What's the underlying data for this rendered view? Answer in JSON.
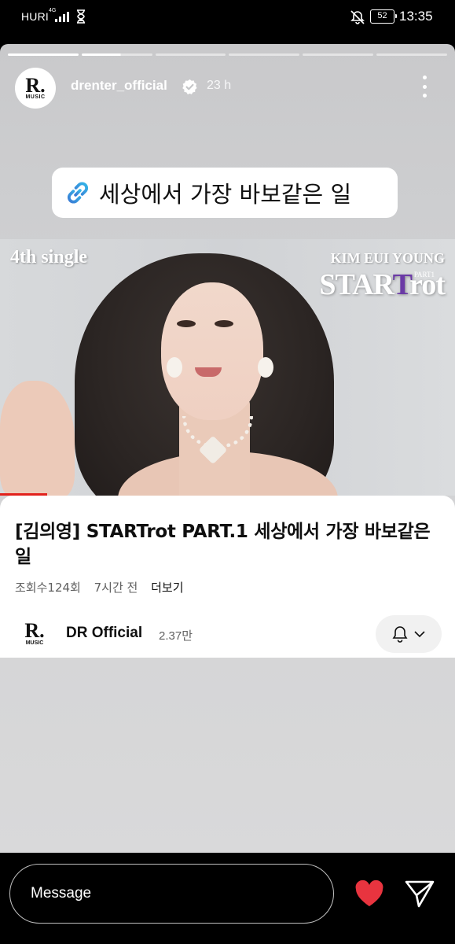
{
  "status_bar": {
    "carrier": "HURI",
    "network": "4G",
    "battery": "52",
    "time": "13:35",
    "icons": [
      "signal-icon",
      "hourglass-icon",
      "bell-off-icon",
      "battery-icon"
    ]
  },
  "story": {
    "progress_total": 6,
    "progress_done": 1,
    "progress_current_fraction": 0.55,
    "username": "drenter_official",
    "time_ago": "23 h",
    "avatar_logo": "R.",
    "avatar_logo_sub": "MUSIC",
    "link_sticker": {
      "icon": "link-icon",
      "text": "세상에서 가장 바보같은 일"
    }
  },
  "video": {
    "thumbnail": {
      "single_label": "4th single",
      "artist_label": "KIM EUI YOUNG",
      "album_label": "STARTrot",
      "part_label": "PART1"
    },
    "title": "[김의영] STARTrot PART.1 세상에서 가장 바보같은 일",
    "views": "조회수124회",
    "uploaded": "7시간 전",
    "more": "더보기",
    "channel": {
      "logo": "R.",
      "logo_sub": "MUSIC",
      "name": "DR Official",
      "subscribers": "2.37만"
    }
  },
  "bottom_bar": {
    "message_placeholder": "Message",
    "like_color": "#e8343f"
  }
}
